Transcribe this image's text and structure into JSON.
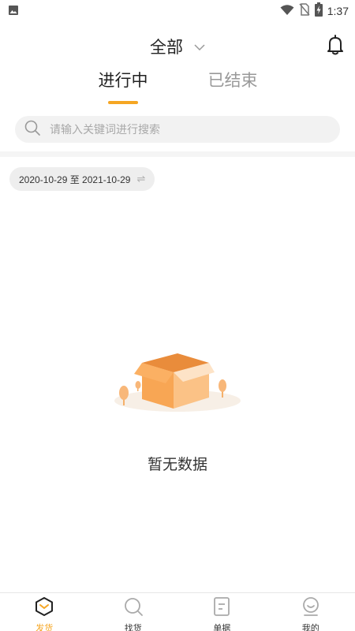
{
  "status_bar": {
    "time": "1:37"
  },
  "header": {
    "title": "全部"
  },
  "tabs": [
    {
      "label": "进行中",
      "active": true
    },
    {
      "label": "已结束",
      "active": false
    }
  ],
  "search": {
    "placeholder": "请输入关键词进行搜索"
  },
  "date_filter": {
    "label": "2020-10-29 至 2021-10-29"
  },
  "empty_state": {
    "message": "暂无数据"
  },
  "bottom_nav": [
    {
      "label": "发货",
      "icon": "ship-icon",
      "active": true
    },
    {
      "label": "找货",
      "icon": "find-goods-icon",
      "active": false
    },
    {
      "label": "单据",
      "icon": "document-icon",
      "active": false
    },
    {
      "label": "我的",
      "icon": "profile-icon",
      "active": false
    }
  ],
  "colors": {
    "accent": "#f5a623",
    "inactive_tab": "#999999",
    "search_bg": "#f2f2f2"
  }
}
